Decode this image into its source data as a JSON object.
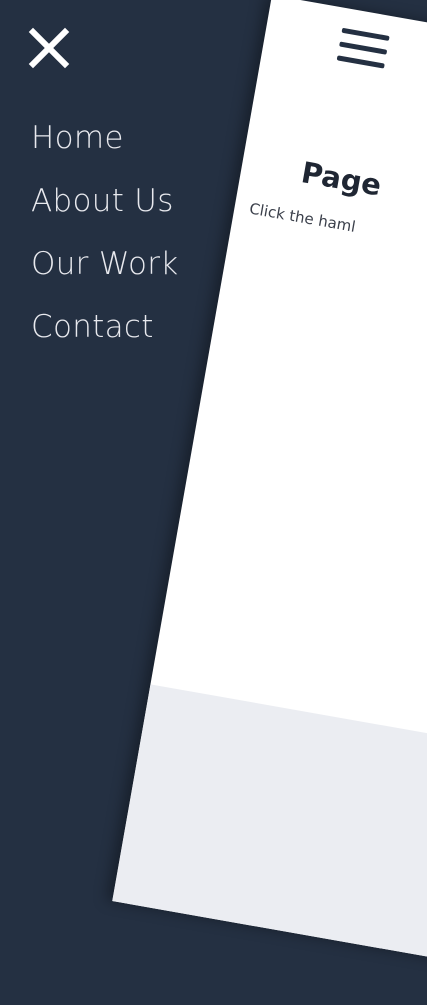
{
  "menu": {
    "close_icon": "close-icon",
    "items": [
      {
        "label": "Home"
      },
      {
        "label": "About Us"
      },
      {
        "label": "Our Work"
      },
      {
        "label": "Contact"
      }
    ]
  },
  "page": {
    "menu_icon": "hamburger-icon",
    "title": "Page",
    "text": "Click the haml"
  },
  "colors": {
    "drawer_background": "#243042",
    "menu_text": "#e8e9ee",
    "page_background": "#ffffff",
    "page_footer_band": "#ebedf2"
  }
}
